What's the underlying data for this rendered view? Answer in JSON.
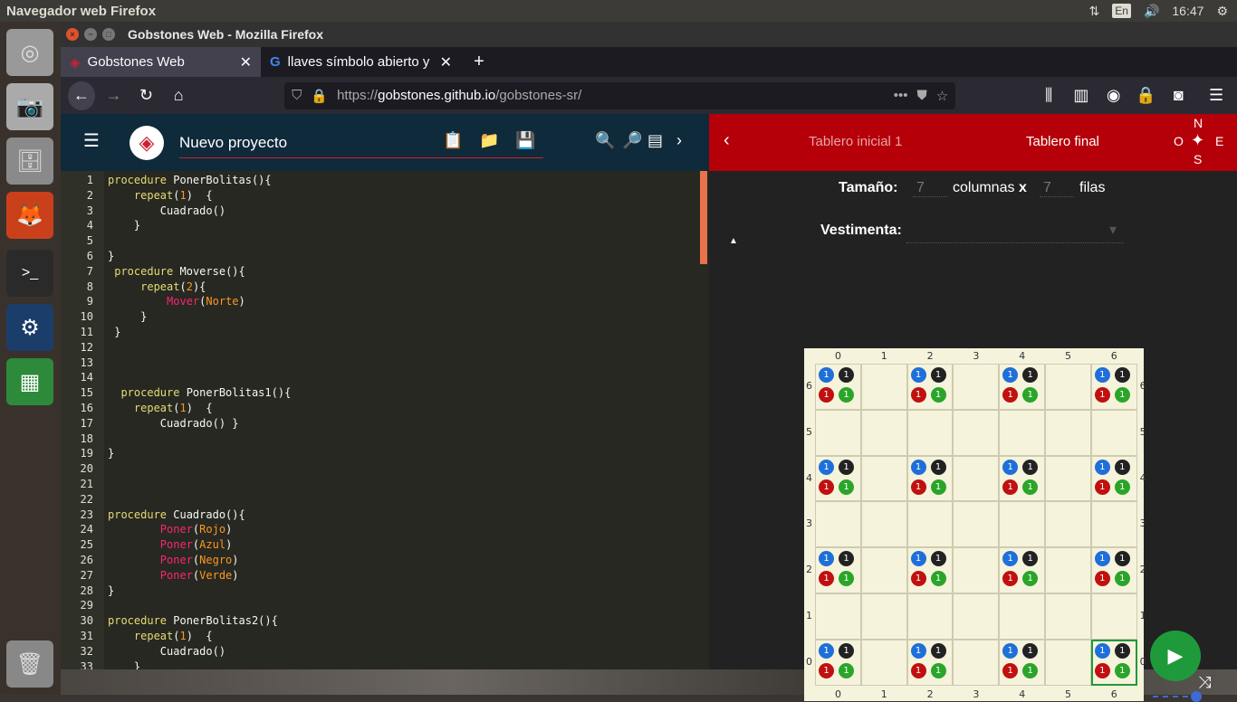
{
  "topbar": {
    "title": "Navegador web Firefox",
    "lang": "En",
    "time": "16:47"
  },
  "window": {
    "title": "Gobstones Web - Mozilla Firefox"
  },
  "tabs": [
    {
      "label": "Gobstones Web",
      "active": true
    },
    {
      "label": "llaves símbolo abierto y",
      "active": false
    }
  ],
  "url": {
    "scheme": "https://",
    "host": "gobstones.github.io",
    "path": "/gobstones-sr/"
  },
  "editor": {
    "project_name": "Nuevo proyecto",
    "lines": [
      "procedure PonerBolitas(){",
      "    repeat(1)  {",
      "        Cuadrado()",
      "    }",
      "",
      "}",
      " procedure Moverse(){",
      "     repeat(2){",
      "         Mover(Norte)",
      "     }",
      " }",
      "",
      "",
      "",
      "  procedure PonerBolitas1(){",
      "    repeat(1)  {",
      "        Cuadrado() }",
      "",
      "}",
      "",
      "",
      "",
      "procedure Cuadrado(){",
      "        Poner(Rojo)",
      "        Poner(Azul)",
      "        Poner(Negro)",
      "        Poner(Verde)",
      "}",
      "",
      "procedure PonerBolitas2(){",
      "    repeat(1)  {",
      "        Cuadrado()",
      "    }"
    ]
  },
  "board_panel": {
    "back_label": "Tablero inicial 1",
    "final_label": "Tablero final",
    "compass": {
      "n": "N",
      "s": "S",
      "e": "E",
      "o": "O"
    },
    "size_label": "Tamaño:",
    "columns_value": "7",
    "columns_label": "columnas",
    "times": "x",
    "rows_value": "7",
    "rows_label": "filas",
    "outfit_label": "Vestimenta:",
    "col_labels": [
      "0",
      "1",
      "2",
      "3",
      "4",
      "5",
      "6"
    ],
    "row_labels": [
      "6",
      "5",
      "4",
      "3",
      "2",
      "1",
      "0"
    ],
    "filled_rows": [
      6,
      4,
      2,
      0
    ],
    "filled_cols": [
      0,
      2,
      4,
      6
    ],
    "ball_count": "1",
    "colors": {
      "blue": "#1e6fd9",
      "black": "#222222",
      "red": "#c01010",
      "green": "#2aa52a"
    }
  },
  "colors": {
    "header_red": "#b5000a",
    "header_dark": "#0f2a3a",
    "play_green": "#1f9a3a"
  }
}
